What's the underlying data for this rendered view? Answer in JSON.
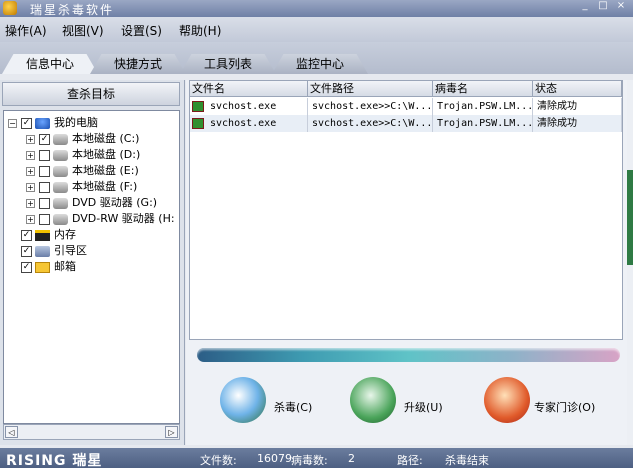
{
  "window": {
    "title": "瑞星杀毒软件",
    "buttons": [
      "_",
      "□",
      "×"
    ]
  },
  "menu": [
    "操作(A)",
    "视图(V)",
    "设置(S)",
    "帮助(H)"
  ],
  "tabs": [
    "信息中心",
    "快捷方式",
    "工具列表",
    "监控中心"
  ],
  "left": {
    "header": "查杀目标",
    "tree": [
      {
        "label": "我的电脑",
        "icon": "computer-icon",
        "checked": true
      },
      {
        "label": "本地磁盘 (C:)",
        "icon": "disk-icon",
        "checked": true
      },
      {
        "label": "本地磁盘 (D:)",
        "icon": "disk-icon",
        "checked": false
      },
      {
        "label": "本地磁盘 (E:)",
        "icon": "disk-icon",
        "checked": false
      },
      {
        "label": "本地磁盘 (F:)",
        "icon": "disk-icon",
        "checked": false
      },
      {
        "label": "DVD 驱动器 (G:)",
        "icon": "dvd-icon",
        "checked": false
      },
      {
        "label": "DVD-RW 驱动器 (H:",
        "icon": "dvd-icon",
        "checked": false
      },
      {
        "label": "内存",
        "icon": "memory-icon",
        "checked": true
      },
      {
        "label": "引导区",
        "icon": "boot-sector-icon",
        "checked": true
      },
      {
        "label": "邮箱",
        "icon": "mailbox-icon",
        "checked": true
      }
    ],
    "scroll_left": "◁",
    "scroll_right": "▷"
  },
  "table": {
    "headers": [
      "文件名",
      "文件路径",
      "病毒名",
      "状态"
    ],
    "rows": [
      {
        "name": "svchost.exe",
        "path": "svchost.exe>>C:\\W...",
        "virus": "Trojan.PSW.LM...",
        "status": "清除成功"
      },
      {
        "name": "svchost.exe",
        "path": "svchost.exe>>C:\\W...",
        "virus": "Trojan.PSW.LM...",
        "status": "清除成功"
      }
    ]
  },
  "actions": [
    {
      "label": "杀毒(C)",
      "icon": "magnifier-scan-icon"
    },
    {
      "label": "升级(U)",
      "icon": "upgrade-arrow-icon"
    },
    {
      "label": "专家门诊(O)",
      "icon": "heart-hand-icon"
    }
  ],
  "status": {
    "logo": "RISING 瑞星",
    "files_label": "文件数:",
    "files_value": "16079",
    "virus_label": "病毒数:",
    "virus_value": "2",
    "path_label": "路径:",
    "path_value": "杀毒结束"
  },
  "colors": {
    "accent": "#4d5f82",
    "progress_start": "#2c5d86",
    "progress_end": "#d8a3c6"
  }
}
